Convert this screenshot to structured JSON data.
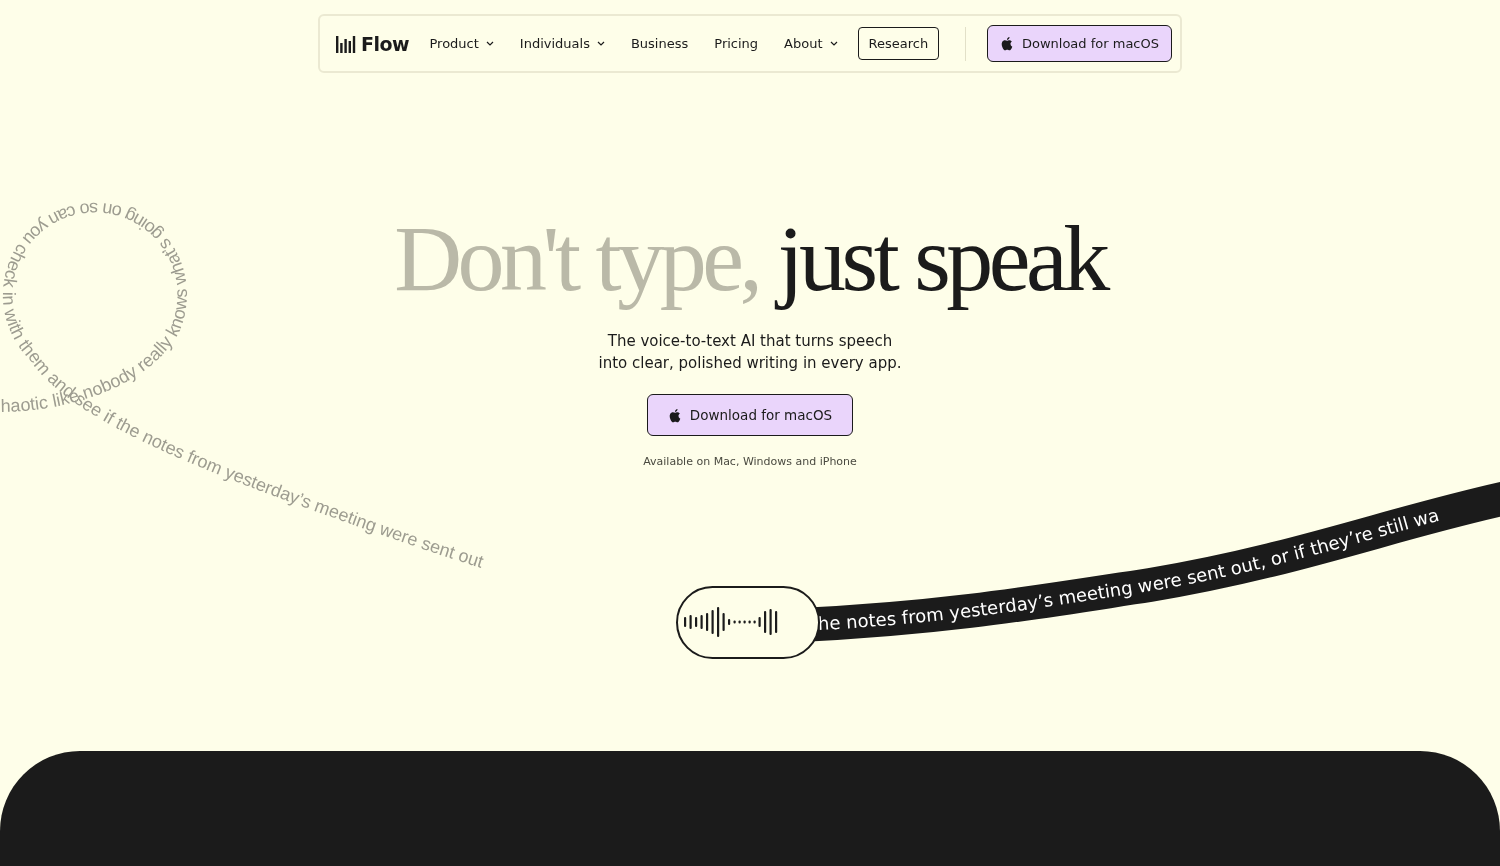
{
  "nav": {
    "brand": "Flow",
    "items": [
      {
        "label": "Product",
        "dropdown": true
      },
      {
        "label": "Individuals",
        "dropdown": true
      },
      {
        "label": "Business",
        "dropdown": false
      },
      {
        "label": "Pricing",
        "dropdown": false
      },
      {
        "label": "About",
        "dropdown": true
      }
    ],
    "outline_button": "Research",
    "cta": "Download for macOS"
  },
  "hero": {
    "title_muted": "Don't type,",
    "title_strong": "just speak",
    "subtitle_lines": [
      "The voice-to-text AI that turns speech",
      "into clear, polished writing in every app."
    ],
    "button": "Download for macOS",
    "note": "Available on Mac, Windows and iPhone"
  },
  "demo": {
    "raw_text": "haotic like nobody really knows what’s going on so can you check in with them and see if the notes from yesterday’s meeting were sent out",
    "polished_text": "he notes from yesterday’s meeting were sent out, or if they’re still wa"
  }
}
